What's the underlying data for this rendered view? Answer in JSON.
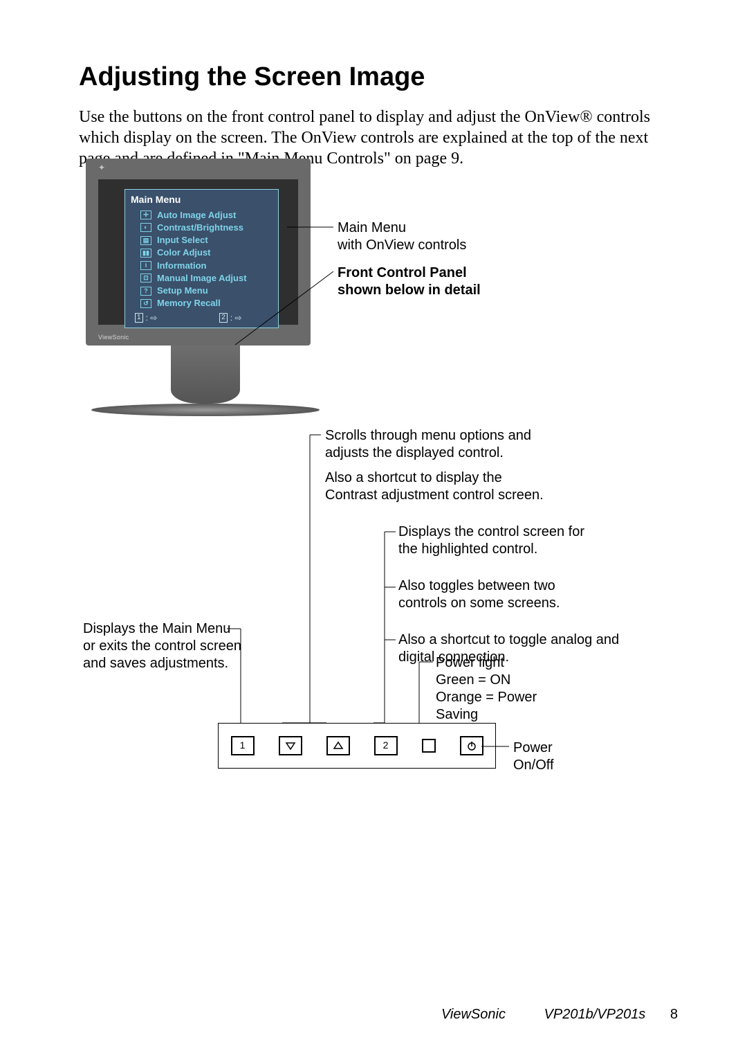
{
  "title": "Adjusting the Screen Image",
  "intro": "Use the buttons on the front control panel to display and adjust the OnView® controls which display on the screen. The OnView controls are explained at the top of the next page and are defined in \"Main Menu Controls\" on page 9.",
  "osd": {
    "title": "Main Menu",
    "items": [
      "Auto Image Adjust",
      "Contrast/Brightness",
      "Input Select",
      "Color Adjust",
      "Information",
      "Manual Image Adjust",
      "Setup Menu",
      "Memory Recall"
    ],
    "footer_left": "1",
    "footer_right": "2"
  },
  "callouts": {
    "main_menu": "Main Menu\nwith OnView controls",
    "front_panel": "Front Control Panel\nshown below in detail",
    "button1": "Displays the Main Menu or exits the control screen and saves adjustments.",
    "arrows": "Scrolls through menu options and adjusts the displayed control.",
    "arrows_shortcut": "Also a shortcut to display the Contrast adjustment control screen.",
    "button2_a": "Displays the control screen for the highlighted control.",
    "button2_b": "Also toggles between two controls on some screens.",
    "button2_c": "Also a shortcut to toggle analog and digital connection.",
    "powerlight": "Power light\nGreen = ON\nOrange = Power\n            Saving",
    "power": "Power\nOn/Off"
  },
  "buttons": {
    "b1": "1",
    "b2": "2"
  },
  "footer": {
    "brand": "ViewSonic",
    "model": "VP201b/VP201s",
    "page": "8"
  }
}
